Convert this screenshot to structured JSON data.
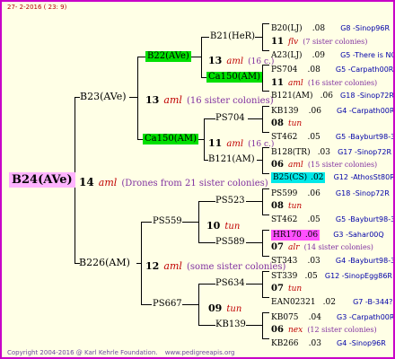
{
  "header": {
    "date": "27-  2-2016 ( 23:  9)"
  },
  "footer": {
    "copyright": "Copyright 2004-2016 @ Karl Kehrle Foundation.",
    "url": "www.pedigreeapis.org"
  },
  "root": {
    "label": "B24(AVe)",
    "count": "14",
    "aml": "aml",
    "note": "(Drones from 21 sister colonies)"
  },
  "gen1": {
    "top": {
      "label": "B23(AVe)",
      "count": "13",
      "aml": "aml",
      "note": "(16 sister colonies)"
    },
    "bottom": {
      "label": "B226(AM)",
      "count": "12",
      "aml": "aml",
      "note": "(some sister colonies)"
    }
  },
  "gen2": {
    "a": {
      "label": "B22(AVe)",
      "count": "13",
      "aml": "aml",
      "note": "(16 c.)"
    },
    "b": {
      "label": "Ca150(AM)",
      "count": "11",
      "aml": "aml",
      "note": "(16 c.)"
    },
    "c": {
      "label": "PS559",
      "count": "10",
      "aml": "tun"
    },
    "d": {
      "label": "PS667",
      "count": "09",
      "aml": "tun"
    }
  },
  "gen3": {
    "a1": {
      "label": "B21(HeR)"
    },
    "a2": {
      "label": "Ca150(AM)",
      "count": "11",
      "aml": "aml",
      "note": "(16 c.)"
    },
    "b1": {
      "label": "PS704",
      "count": "08",
      "aml": "tun"
    },
    "b2": {
      "label": "B121(AM)",
      "count": "06",
      "aml": "aml",
      "note": "(15 sister colonies)"
    },
    "c1": {
      "label": "PS523",
      "count": "08",
      "aml": "tun"
    },
    "c2": {
      "label": "PS589",
      "count": "07",
      "aml": "alr",
      "note": "(14 sister colonies)"
    },
    "d1": {
      "label": "PS634",
      "count": "07",
      "aml": "tun"
    },
    "d2": {
      "label": "KB139",
      "count": "06",
      "aml": "nex",
      "note": "(12 sister colonies)"
    }
  },
  "gen4": [
    {
      "label": "B20(LJ)",
      "year": ".08",
      "info": "G8 -Sinop96R"
    },
    {
      "count": "11",
      "aml": "flv",
      "note": "(7 sister colonies)"
    },
    {
      "label": "A23(LJ)",
      "year": ".09",
      "info": "G5 -There is NO"
    },
    {
      "label": "PS704",
      "year": ".08",
      "info": "G5 -Carpath00R"
    },
    {
      "count": "11",
      "aml": "aml",
      "note": "(16 sister colonies)"
    },
    {
      "label": "B121(AM)",
      "year": ".06",
      "info": "G18 -Sinop72R"
    },
    {
      "label": "KB139",
      "year": ".06",
      "info": "G4 -Carpath00R"
    },
    {
      "count": "08",
      "aml": "tun"
    },
    {
      "label": "ST462",
      "year": ".05",
      "info": "G5 -Bayburt98-3"
    },
    {
      "label": "B128(TR)",
      "year": ".03",
      "info": "G17 -Sinop72R"
    },
    {
      "count": "06",
      "aml": "aml",
      "note": "(15 sister colonies)"
    },
    {
      "label": "B25(CS)",
      "year": ".02",
      "info": "G12 -AthosSt80R"
    },
    {
      "label": "PS599",
      "year": ".06",
      "info": "G18 -Sinop72R"
    },
    {
      "count": "08",
      "aml": "tun"
    },
    {
      "label": "ST462",
      "year": ".05",
      "info": "G5 -Bayburt98-3"
    },
    {
      "label": "HR170",
      "year": ".06",
      "info": "G3 -Sahar00Q"
    },
    {
      "count": "07",
      "aml": "alr",
      "note": "(14 sister colonies)"
    },
    {
      "label": "ST343",
      "year": ".03",
      "info": "G4 -Bayburt98-3"
    },
    {
      "label": "ST339",
      "year": ".05",
      "info": "G12 -SinopEgg86R"
    },
    {
      "count": "07",
      "aml": "tun"
    },
    {
      "label": "EAN02321",
      "year": ".02",
      "info": "G7 -B-344?"
    },
    {
      "label": "KB075",
      "year": ".04",
      "info": "G3 -Carpath00R"
    },
    {
      "count": "06",
      "aml": "nex",
      "note": "(12 sister colonies)"
    },
    {
      "label": "KB266",
      "year": ".03",
      "info": "G4 -Sinop96R"
    }
  ],
  "colors": {
    "frame": "#c800c8",
    "background": "#ffffe6",
    "green": "#00e000",
    "cyan": "#00e8e8",
    "pink": "#ff50ff",
    "red": "#c00000",
    "blue": "#0000a8",
    "purple": "#8030a0"
  }
}
